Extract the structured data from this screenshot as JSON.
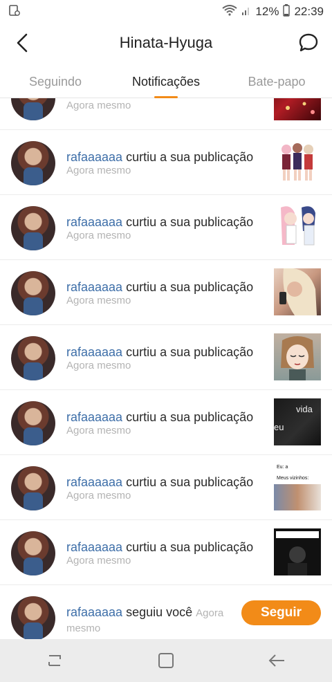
{
  "status_bar": {
    "battery": "12%",
    "time": "22:39"
  },
  "header": {
    "title": "Hinata-Hyuga"
  },
  "tabs": [
    {
      "label": "Seguindo"
    },
    {
      "label": "Notificações"
    },
    {
      "label": "Bate-papo"
    }
  ],
  "notifications": [
    {
      "user": "",
      "action": "",
      "time": "Agora mesmo",
      "thumb": "christmas-tree"
    },
    {
      "user": "rafaaaaaa",
      "action": " curtiu a sua publicação",
      "time": "Agora mesmo",
      "thumb": "anime-girls-group"
    },
    {
      "user": "rafaaaaaa",
      "action": " curtiu a sua publicação",
      "time": "Agora mesmo",
      "thumb": "anime-pink-hair"
    },
    {
      "user": "rafaaaaaa",
      "action": " curtiu a sua publicação",
      "time": "Agora mesmo",
      "thumb": "blonde-selfie"
    },
    {
      "user": "rafaaaaaa",
      "action": " curtiu a sua publicação",
      "time": "Agora mesmo",
      "thumb": "anime-girl-eyes-closed"
    },
    {
      "user": "rafaaaaaa",
      "action": " curtiu a sua publicação",
      "time": "Agora mesmo",
      "thumb": "vida-eu-meme"
    },
    {
      "user": "rafaaaaaa",
      "action": " curtiu a sua publicação",
      "time": "Agora mesmo",
      "thumb": "eu-a-meus-vizinhos-meme"
    },
    {
      "user": "rafaaaaaa",
      "action": " curtiu a sua publicação",
      "time": "Agora mesmo",
      "thumb": "dark-meme"
    }
  ],
  "thumb_texts": {
    "vida": "vida",
    "eu": "eu",
    "meme_top": "Eu: a",
    "meme_mid": "Meus vizinhos:"
  },
  "follow_row": {
    "user": "rafaaaaaa",
    "action": " seguiu você",
    "time": "Agora mesmo",
    "button": "Seguir"
  },
  "colors": {
    "accent": "#f28b18",
    "username": "#3d6ea8"
  }
}
